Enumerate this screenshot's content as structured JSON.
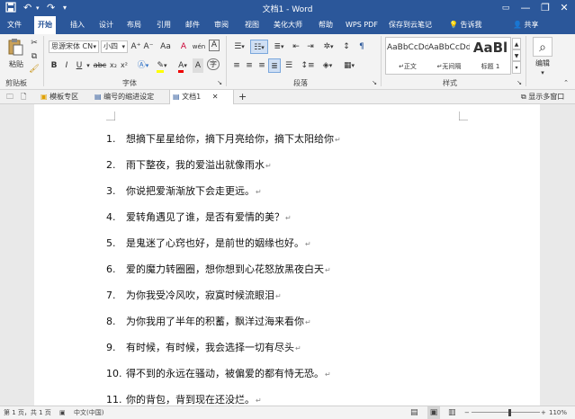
{
  "window": {
    "title": "文档1 - Word",
    "minimize": "—",
    "restore": "❐",
    "close": "✕"
  },
  "quick_access": {
    "save_icon": "save-icon",
    "undo_icon": "undo-icon",
    "redo_icon": "redo-icon"
  },
  "tabs": [
    {
      "label": "文件"
    },
    {
      "label": "开始"
    },
    {
      "label": "插入"
    },
    {
      "label": "设计"
    },
    {
      "label": "布局"
    },
    {
      "label": "引用"
    },
    {
      "label": "邮件"
    },
    {
      "label": "审阅"
    },
    {
      "label": "视图"
    },
    {
      "label": "美化大师"
    },
    {
      "label": "帮助"
    },
    {
      "label": "WPS PDF"
    },
    {
      "label": "保存到云笔记"
    },
    {
      "label": "告诉我"
    }
  ],
  "share_label": "共享",
  "ribbon": {
    "clipboard": {
      "paste_label": "粘贴",
      "group_label": "剪贴板"
    },
    "font": {
      "font_name": "思源宋体 CN",
      "font_size": "小四",
      "group_label": "字体",
      "bold": "B",
      "italic": "I",
      "underline": "U",
      "strike": "abc",
      "sub": "x₂",
      "sup": "x²",
      "grow": "A⁺",
      "shrink": "A⁻",
      "case": "Aa",
      "clear": "A",
      "phonetic": "wén",
      "border": "A"
    },
    "paragraph": {
      "group_label": "段落"
    },
    "styles": {
      "group_label": "样式",
      "items": [
        {
          "preview": "AaBbCcDd",
          "name": "↵正文"
        },
        {
          "preview": "AaBbCcDd",
          "name": "↵无间隔"
        },
        {
          "preview": "AaBl",
          "name": "标题 1"
        }
      ]
    },
    "editing": {
      "label": "编辑"
    }
  },
  "doc_tabs": {
    "items": [
      {
        "label": "模板专区"
      },
      {
        "label": "编号的缩进设定"
      },
      {
        "label": "文档1"
      }
    ],
    "add": "+",
    "multi_window": "显示多窗口"
  },
  "document": {
    "items": [
      {
        "num": "1.",
        "text": "想摘下星星给你，摘下月亮给你，摘下太阳给你"
      },
      {
        "num": "2.",
        "text": "雨下整夜，我的爱溢出就像雨水"
      },
      {
        "num": "3.",
        "text": "你说把爱渐渐放下会走更远。"
      },
      {
        "num": "4.",
        "text": "爱转角遇见了谁，是否有爱情的美？"
      },
      {
        "num": "5.",
        "text": "是鬼迷了心窍也好，是前世的姻缘也好。"
      },
      {
        "num": "6.",
        "text": "爱的魔力转圈圈，想你想到心花怒放黑夜白天"
      },
      {
        "num": "7.",
        "text": "为你我受冷风吹，寂寞时候流眼泪"
      },
      {
        "num": "8.",
        "text": "为你我用了半年的积蓄，飘洋过海来看你"
      },
      {
        "num": "9.",
        "text": "有时候，有时候，我会选择一切有尽头"
      },
      {
        "num": "10.",
        "text": "得不到的永远在骚动，被偏爱的都有恃无恐。"
      },
      {
        "num": "11.",
        "text": "你的背包，背到现在还没烂。"
      }
    ],
    "para_mark": "↵"
  },
  "status": {
    "page": "第 1 页，共 1 页",
    "language": "中文(中国)",
    "zoom": "110%",
    "zoom_level": 0.55
  }
}
